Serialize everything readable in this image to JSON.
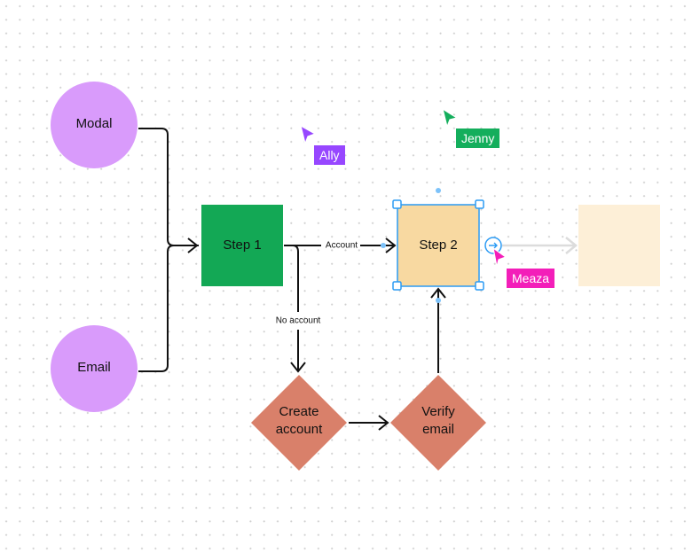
{
  "colors": {
    "circle": "#d99bfb",
    "step1": "#13a855",
    "step2": "#f8d9a1",
    "diamond": "#d9806a",
    "ghost": "#fdefd7",
    "selection": "#2b9bf4",
    "edge": "#111111",
    "ghost_edge": "#dcdcdc"
  },
  "nodes": {
    "modal": "Modal",
    "email": "Email",
    "step1": "Step 1",
    "step2": "Step 2",
    "create_account_line1": "Create",
    "create_account_line2": "account",
    "verify_email_line1": "Verify",
    "verify_email_line2": "email"
  },
  "edges": {
    "account_label": "Account",
    "no_account_label": "No account"
  },
  "cursors": [
    {
      "name": "Ally",
      "color": "#9747ff"
    },
    {
      "name": "Jenny",
      "color": "#14ae5c"
    },
    {
      "name": "Meaza",
      "color": "#f31eb9"
    }
  ]
}
